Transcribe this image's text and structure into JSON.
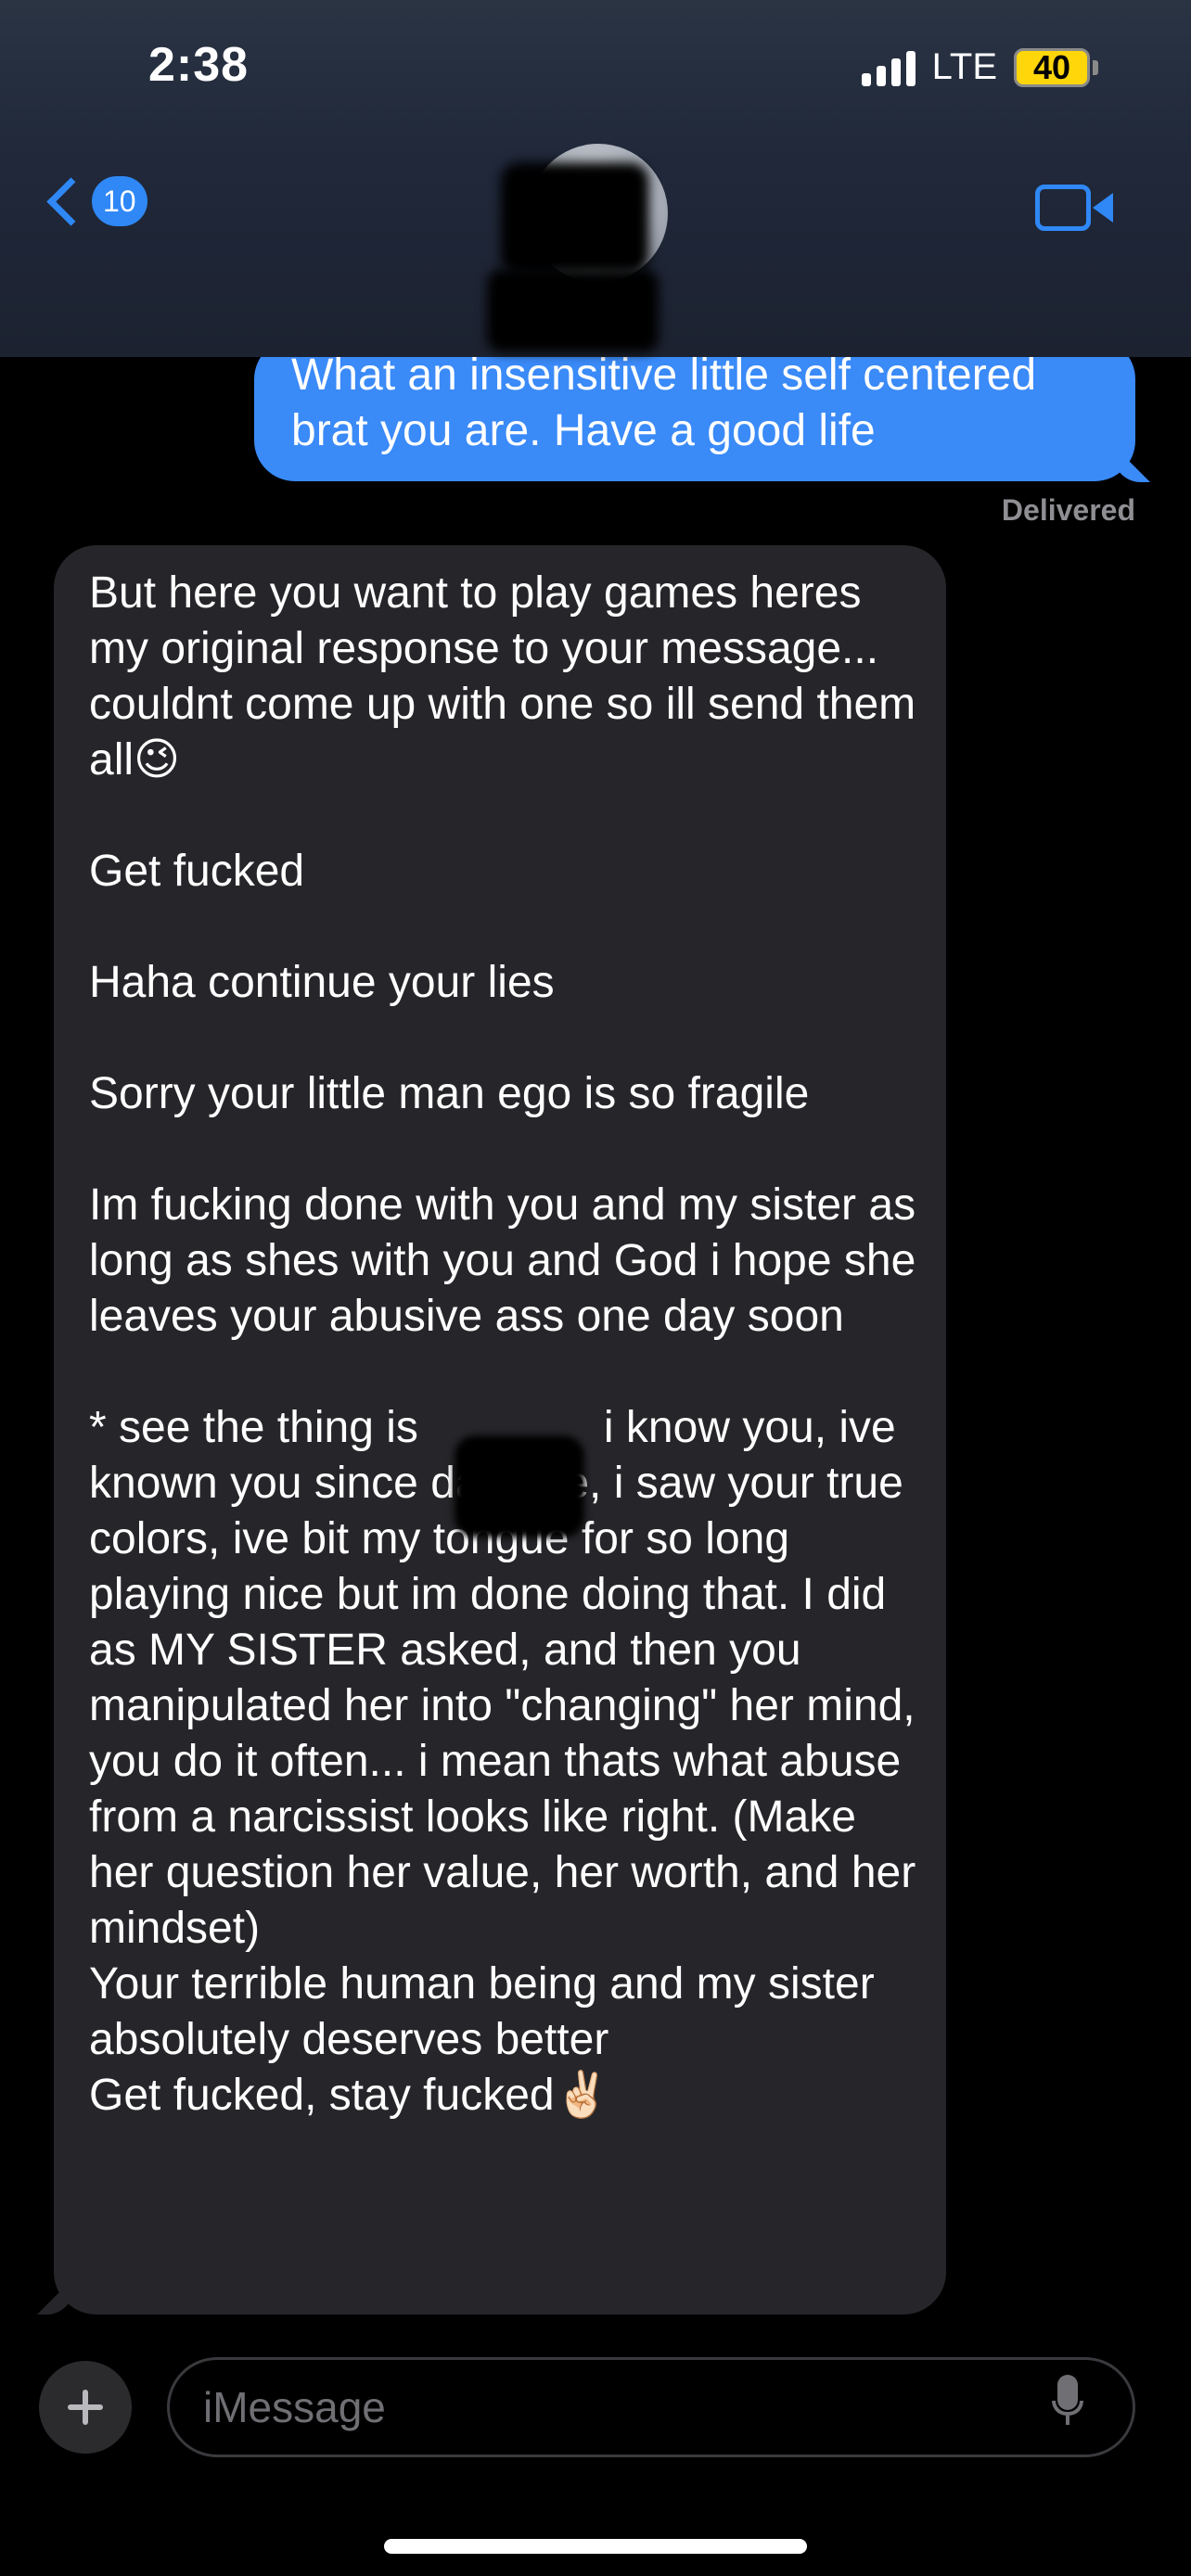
{
  "status_bar": {
    "time": "2:38",
    "network": "LTE",
    "battery": "40"
  },
  "nav": {
    "back_count": "10"
  },
  "messages": {
    "sent_text": "What an insensitive little self centered brat you are. Have a good life",
    "delivered": "Delivered",
    "received_text": "But here you want to play games heres my original response to your message... couldnt come up with one so ill send them all😉\n\nGet fucked\n\nHaha continue your lies\n\nSorry your little man ego is so fragile\n\nIm fucking done with you and my sister as long as shes with you and God i hope she leaves your abusive ass one day soon\n\n* see the thing is               i know you, ive known you since day one, i saw your true colors, ive bit my tongue for so long playing nice but im done doing that. I did as MY SISTER asked, and then you manipulated her into \"changing\" her mind, you do it often... i mean thats what abuse from a narcissist looks like right. (Make her question her value, her worth, and her mindset)\nYour terrible human being and my sister absolutely deserves better\nGet fucked, stay fucked✌🏻"
  },
  "composer": {
    "placeholder": "iMessage"
  },
  "colors": {
    "accent": "#2f88f5",
    "sent_bubble": "#3a8af8",
    "received_bubble": "#26262a",
    "battery": "#ffd60a"
  },
  "icons": {
    "back": "chevron-left-icon",
    "video": "video-camera-icon",
    "plus": "plus-icon",
    "mic": "microphone-icon"
  }
}
